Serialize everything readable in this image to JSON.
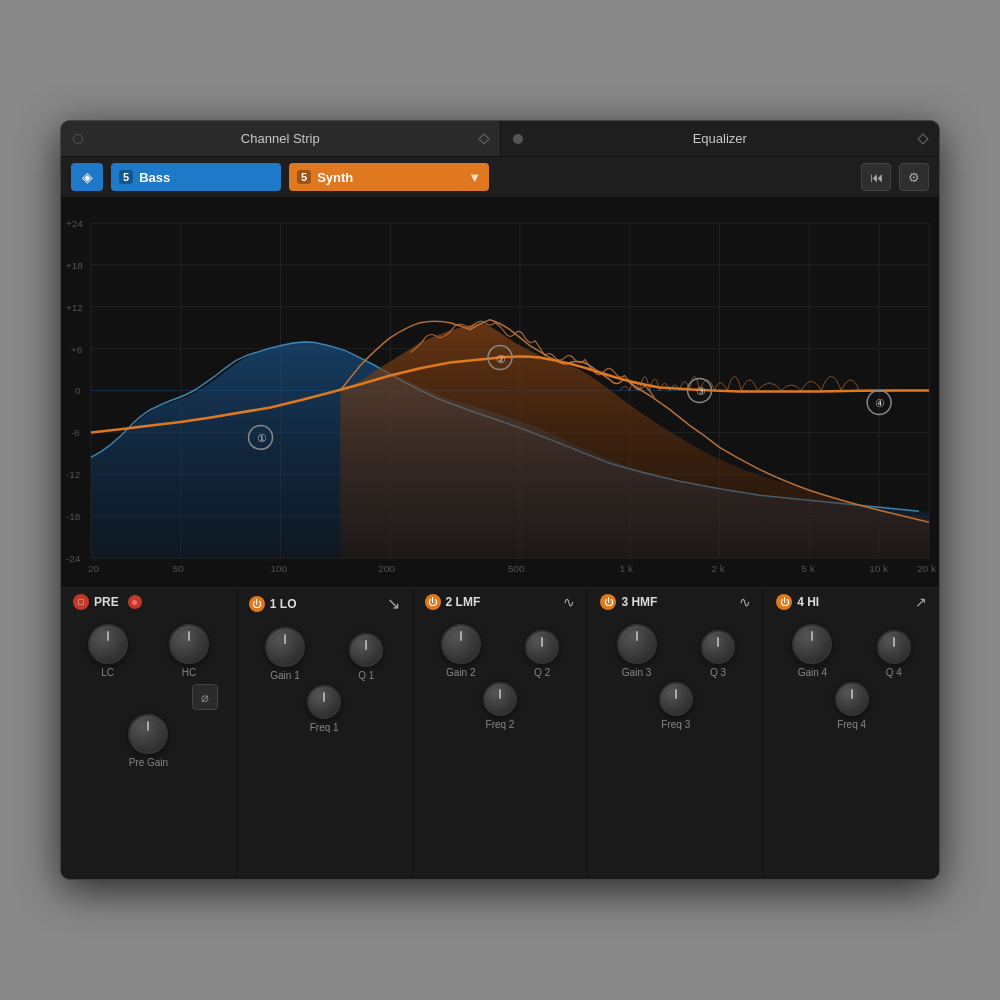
{
  "titleBar": {
    "tab1": {
      "label": "Channel Strip",
      "dotType": "empty"
    },
    "tab2": {
      "label": "Equalizer",
      "dotType": "filled"
    }
  },
  "toolbar": {
    "logoIcon": "◈",
    "trackNum": "5",
    "trackName": "Bass",
    "presetNum": "5",
    "presetName": "Synth",
    "rewindIcon": "⏮",
    "settingsIcon": "⚙"
  },
  "eqDisplay": {
    "dbLabels": [
      "+24",
      "+18",
      "+12",
      "+6",
      "0",
      "-6",
      "-12",
      "-18",
      "-24"
    ],
    "freqLabels": [
      "20",
      "50",
      "100",
      "200",
      "500",
      "1 k",
      "2 k",
      "5 k",
      "10 k",
      "20 k"
    ],
    "nodes": [
      {
        "id": 1,
        "label": "①"
      },
      {
        "id": 2,
        "label": "②"
      },
      {
        "id": 3,
        "label": "③"
      },
      {
        "id": 4,
        "label": "④"
      }
    ]
  },
  "panels": {
    "pre": {
      "label": "PRE",
      "knobs": [
        {
          "id": "lc",
          "label": "LC"
        },
        {
          "id": "hc",
          "label": "HC"
        },
        {
          "id": "pre-gain",
          "label": "Pre Gain"
        }
      ],
      "phaseLabel": "⌀"
    },
    "band1": {
      "num": "1",
      "label": "LO",
      "shapeIcon": "↘",
      "knobs": [
        {
          "id": "gain1",
          "label": "Gain 1"
        },
        {
          "id": "q1",
          "label": "Q 1"
        },
        {
          "id": "freq1",
          "label": "Freq 1"
        }
      ]
    },
    "band2": {
      "num": "2",
      "label": "LMF",
      "shapeIcon": "∿",
      "knobs": [
        {
          "id": "gain2",
          "label": "Gain 2"
        },
        {
          "id": "q2",
          "label": "Q 2"
        },
        {
          "id": "freq2",
          "label": "Freq 2"
        }
      ]
    },
    "band3": {
      "num": "3",
      "label": "HMF",
      "shapeIcon": "∿",
      "knobs": [
        {
          "id": "gain3",
          "label": "Gain 3"
        },
        {
          "id": "q3",
          "label": "Q 3"
        },
        {
          "id": "freq3",
          "label": "Freq 3"
        }
      ]
    },
    "band4": {
      "num": "4",
      "label": "HI",
      "shapeIcon": "↗",
      "knobs": [
        {
          "id": "gain4",
          "label": "Gain 4"
        },
        {
          "id": "q4",
          "label": "Q 4"
        },
        {
          "id": "freq4",
          "label": "Freq 4"
        }
      ]
    }
  }
}
